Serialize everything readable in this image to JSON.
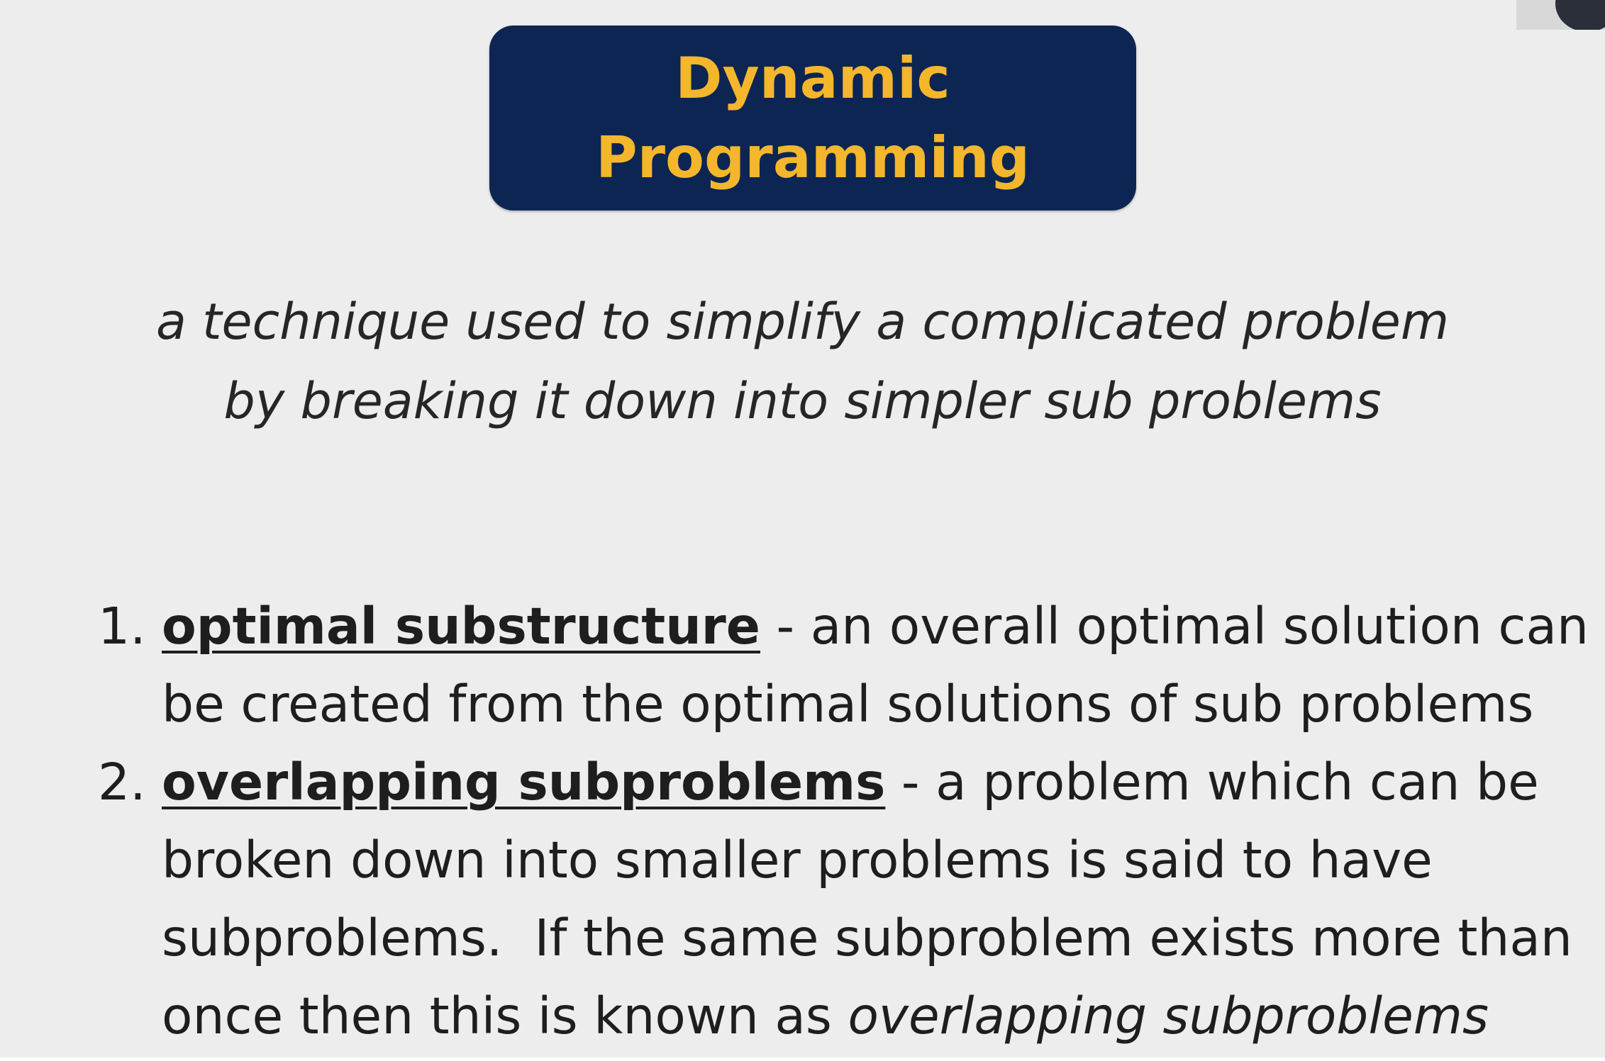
{
  "slide": {
    "title_lines": [
      "Dynamic",
      "Programming"
    ],
    "definition_lines": [
      "a technique used to simplify a complicated problem",
      "by breaking it down into simpler sub problems"
    ],
    "points": [
      {
        "number": "1.",
        "term": "optimal substructure",
        "line1_rest": " - an overall optimal solution can",
        "line2": "be created from the optimal solutions of sub problems"
      },
      {
        "number": "2.",
        "term": "overlapping subproblems",
        "line1_rest": " - a problem which can be",
        "line2": "broken down into smaller problems is said to have",
        "line3": "subproblems.  If the same subproblem exists more than",
        "line4_plain": "once then this is known as ",
        "line4_italic": "overlapping subproblems"
      }
    ]
  },
  "colors": {
    "background": "#ededed",
    "title_box": "#0d2552",
    "title_text": "#f3b62c"
  }
}
